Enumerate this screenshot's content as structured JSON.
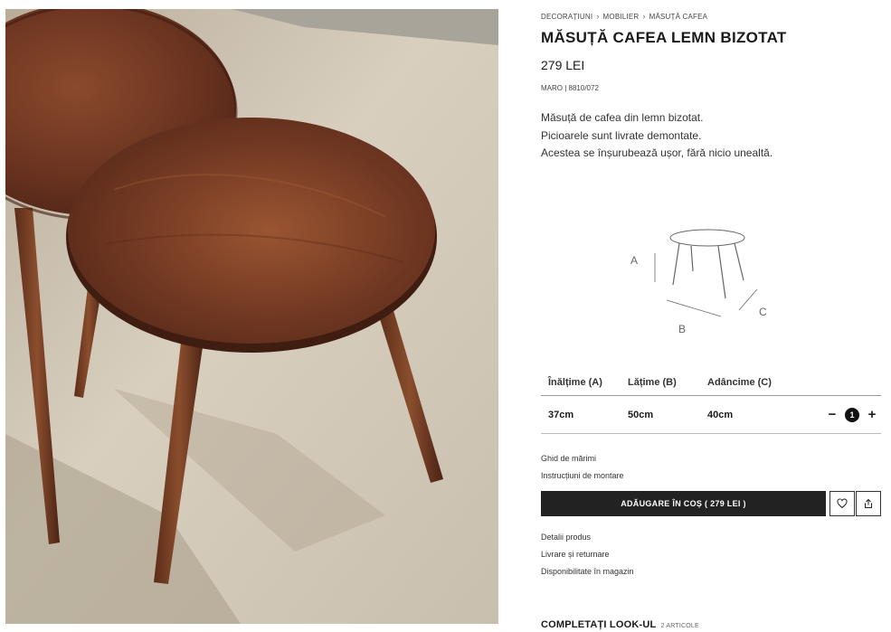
{
  "breadcrumb": [
    "DECORAȚIUNI",
    "MOBILIER",
    "MĂSUȚĂ CAFEA"
  ],
  "product": {
    "title": "MĂSUȚĂ CAFEA LEMN BIZOTAT",
    "price": "279 LEI",
    "reference": "MARO | 8810/072",
    "description": [
      "Măsuță de cafea din lemn bizotat.",
      "Picioarele sunt livrate demontate.",
      "Acestea se înșurubează ușor, fără nicio unealtă."
    ]
  },
  "diagram": {
    "labels": {
      "a": "A",
      "b": "B",
      "c": "C"
    }
  },
  "dimensions": {
    "headers": [
      "Înălțime (A)",
      "Lățime (B)",
      "Adâncime (C)"
    ],
    "values": [
      "37cm",
      "50cm",
      "40cm"
    ]
  },
  "quantity": {
    "minus": "−",
    "value": "1",
    "plus": "+"
  },
  "links": {
    "size_guide": "Ghid de mărimi",
    "assembly": "Instrucțiuni de montare",
    "details": "Detalii produs",
    "delivery": "Livrare și returnare",
    "availability": "Disponibilitate în magazin"
  },
  "cart": {
    "add_label": "ADĂUGARE ÎN COȘ ( 279 LEI )"
  },
  "icons": {
    "favorite": "heart-icon",
    "share": "share-icon"
  },
  "complete_look": {
    "label": "COMPLETAȚI LOOK-UL",
    "count": "2 ARTICOLE"
  }
}
